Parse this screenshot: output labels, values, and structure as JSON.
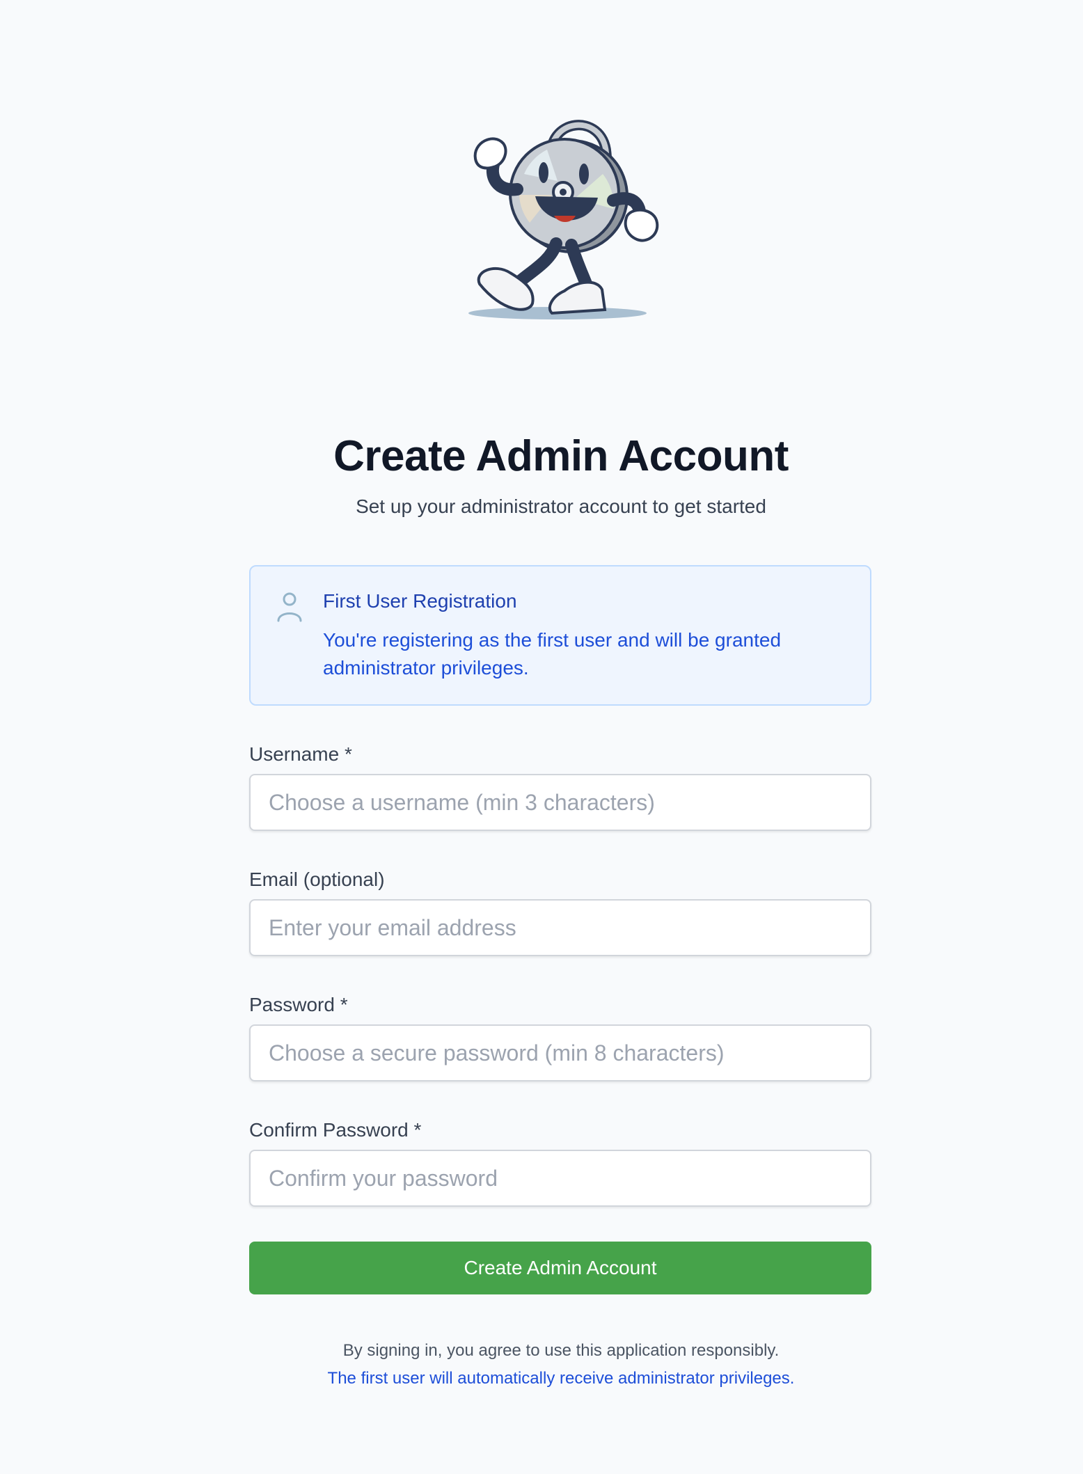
{
  "colors": {
    "background": "#f8fafc",
    "primary_button": "#46a34a",
    "notice_background": "#eff5fe",
    "notice_border": "#bfdbfe",
    "notice_text": "#1d4ed8",
    "link_text": "#1d4ed8"
  },
  "header": {
    "mascot_icon": "cd-mascot-illustration",
    "title": "Create Admin Account",
    "subtitle": "Set up your administrator account to get started"
  },
  "notice": {
    "icon": "user-icon",
    "title": "First User Registration",
    "body": "You're registering as the first user and will be granted administrator privileges."
  },
  "form": {
    "username": {
      "label": "Username *",
      "placeholder": "Choose a username (min 3 characters)",
      "value": ""
    },
    "email": {
      "label": "Email (optional)",
      "placeholder": "Enter your email address",
      "value": ""
    },
    "password": {
      "label": "Password *",
      "placeholder": "Choose a secure password (min 8 characters)",
      "value": ""
    },
    "confirm_password": {
      "label": "Confirm Password *",
      "placeholder": "Confirm your password",
      "value": ""
    },
    "submit_label": "Create Admin Account"
  },
  "footer": {
    "agreement": "By signing in, you agree to use this application responsibly.",
    "admin_note": "The first user will automatically receive administrator privileges."
  }
}
